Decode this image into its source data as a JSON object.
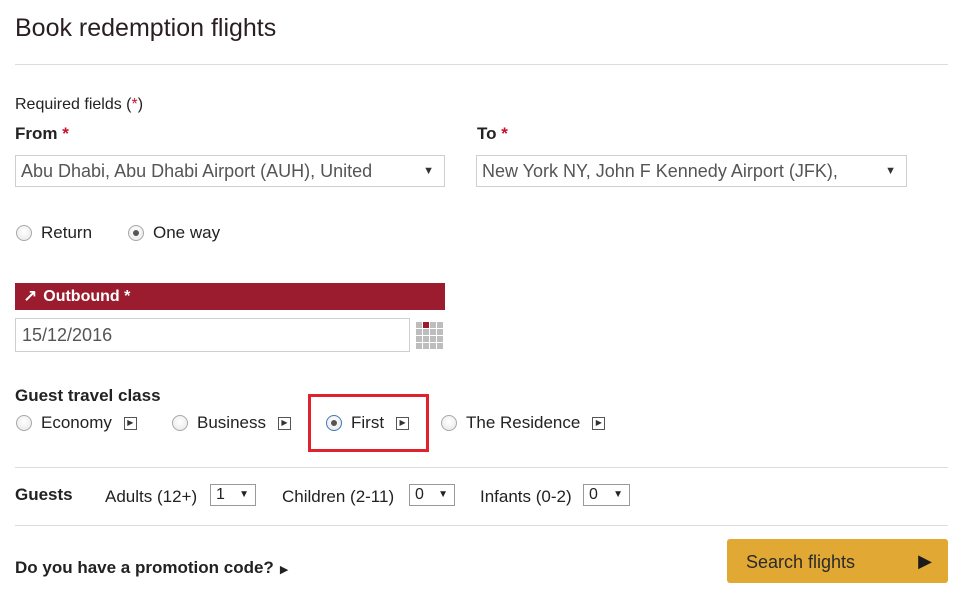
{
  "page": {
    "title": "Book redemption flights",
    "required_note": "Required fields (",
    "required_star": "*",
    "required_close": ")"
  },
  "from": {
    "label": "From",
    "value": "Abu Dhabi, Abu Dhabi Airport (AUH), United"
  },
  "to": {
    "label": "To",
    "value": "New York NY, John F Kennedy Airport (JFK),"
  },
  "trip_type": {
    "options": [
      {
        "label": "Return",
        "checked": false
      },
      {
        "label": "One way",
        "checked": true
      }
    ]
  },
  "outbound": {
    "label": "Outbound *",
    "date": "15/12/2016"
  },
  "travel_class": {
    "heading": "Guest travel class",
    "options": [
      {
        "label": "Economy",
        "checked": false
      },
      {
        "label": "Business",
        "checked": false
      },
      {
        "label": "First",
        "checked": true
      },
      {
        "label": "The Residence",
        "checked": false
      }
    ]
  },
  "guests": {
    "heading": "Guests",
    "adults_label": "Adults (12+)",
    "adults_value": "1",
    "children_label": "Children (2-11)",
    "children_value": "0",
    "infants_label": "Infants (0-2)",
    "infants_value": "0"
  },
  "promo": {
    "label": "Do you have a promotion code?"
  },
  "search": {
    "label": "Search flights"
  },
  "colors": {
    "accent": "#9c1c2f",
    "button": "#e2a834",
    "highlight": "#e0212e"
  },
  "icons": {
    "select_caret": "caret-down-icon",
    "info": "info-play-icon",
    "calendar": "calendar-icon",
    "outbound_arrow": "arrow-up-right-icon",
    "search_go": "play-icon"
  }
}
